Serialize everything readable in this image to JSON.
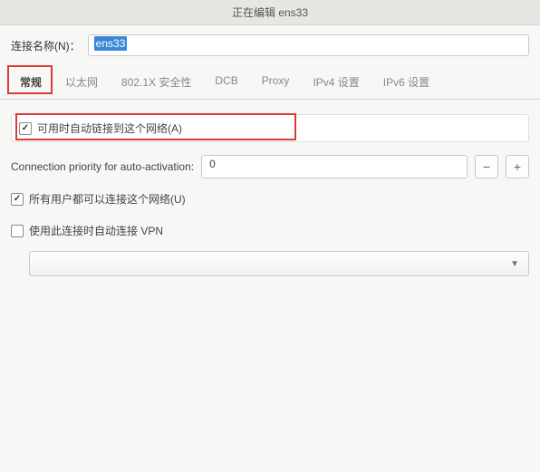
{
  "window": {
    "title": "正在编辑 ens33"
  },
  "connection_name": {
    "label": "连接名称(N)：",
    "value": "ens33"
  },
  "tabs": {
    "general": "常规",
    "ethernet": "以太网",
    "security": "802.1X 安全性",
    "dcb": "DCB",
    "proxy": "Proxy",
    "ipv4": "IPv4 设置",
    "ipv6": "IPv6 设置"
  },
  "general": {
    "auto_connect": {
      "label": "可用时自动链接到这个网络(A)",
      "checked": true
    },
    "priority": {
      "label": "Connection priority for auto-activation:",
      "value": "0"
    },
    "all_users": {
      "label": "所有用户都可以连接这个网络(U)",
      "checked": true
    },
    "auto_vpn": {
      "label": "使用此连接时自动连接 VPN",
      "checked": false
    },
    "vpn_select": {
      "value": ""
    }
  }
}
